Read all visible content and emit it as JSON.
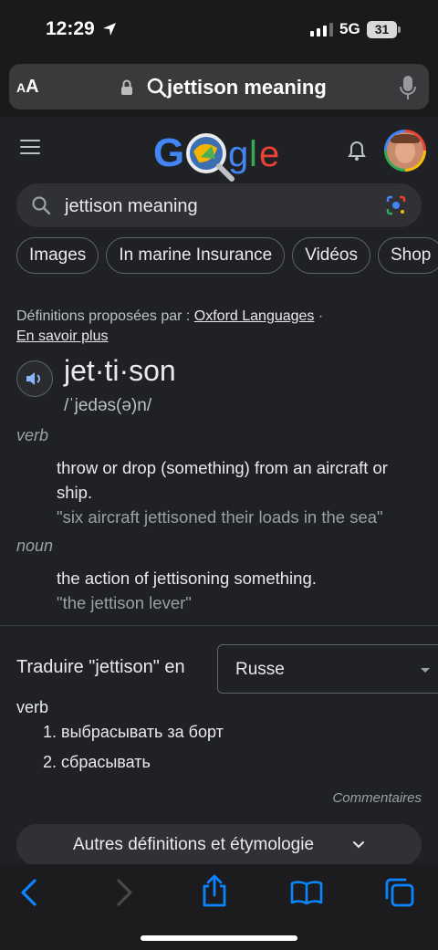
{
  "status": {
    "time": "12:29",
    "network": "5G",
    "battery": "31"
  },
  "address_bar": {
    "aa_label_small": "A",
    "aa_label_big": "A",
    "url": "jettison meaning"
  },
  "google": {
    "search_value": "jettison meaning"
  },
  "chips": [
    "Images",
    "In marine Insurance",
    "Vidéos",
    "Shop"
  ],
  "dictionary": {
    "source_prefix": "Définitions proposées par : ",
    "source_link": "Oxford Languages",
    "source_sep": " ·",
    "learn_more": "En savoir plus",
    "word": "jet·ti·son",
    "phonetic": "/ˈjedəs(ə)n/",
    "senses": [
      {
        "pos": "verb",
        "definition": "throw or drop (something) from an aircraft or ship.",
        "example": "\"six aircraft jettisoned their loads in the sea\""
      },
      {
        "pos": "noun",
        "definition": "the action of jettisoning something.",
        "example": "\"the jettison lever\""
      }
    ]
  },
  "translation": {
    "label": "Traduire \"jettison\" en",
    "language": "Russe",
    "pos": "verb",
    "items": [
      "1. выбрасывать за борт",
      "2. сбрасывать"
    ],
    "feedback": "Commentaires"
  },
  "more_button": "Autres définitions et étymologie",
  "colors": {
    "accent_blue": "#0a84ff",
    "background": "#202124"
  }
}
